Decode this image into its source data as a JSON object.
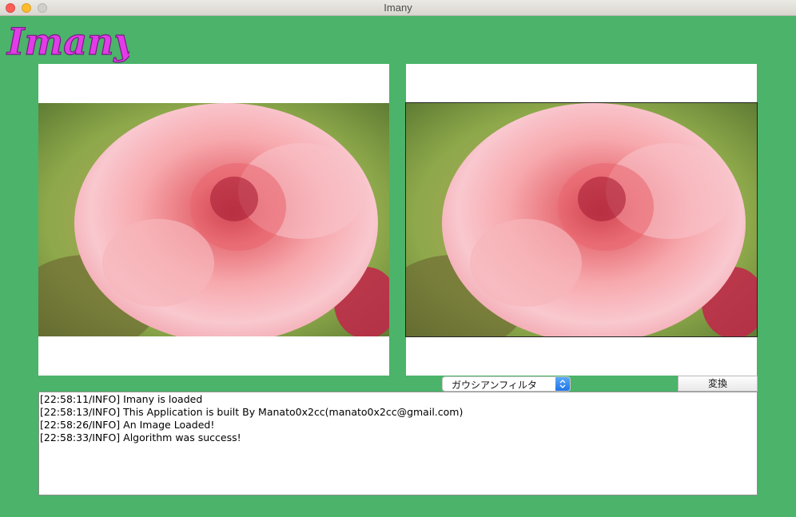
{
  "window": {
    "title": "Imany"
  },
  "logo": {
    "text": "Imany",
    "color": "#e23ce8"
  },
  "panels": {
    "source_image": "rose-photo-original",
    "result_image": "rose-photo-filtered"
  },
  "controls": {
    "filter_selected": "ガウシアンフィルタ",
    "convert_label": "変換"
  },
  "log": {
    "lines": [
      "[22:58:11/INFO] Imany is loaded",
      "[22:58:13/INFO] This Application is built By Manato0x2cc(manato0x2cc@gmail.com)",
      "[22:58:26/INFO] An Image Loaded!",
      "[22:58:33/INFO] Algorithm was success!"
    ]
  },
  "colors": {
    "background": "#4bb36a",
    "accent": "#1f75e8"
  }
}
